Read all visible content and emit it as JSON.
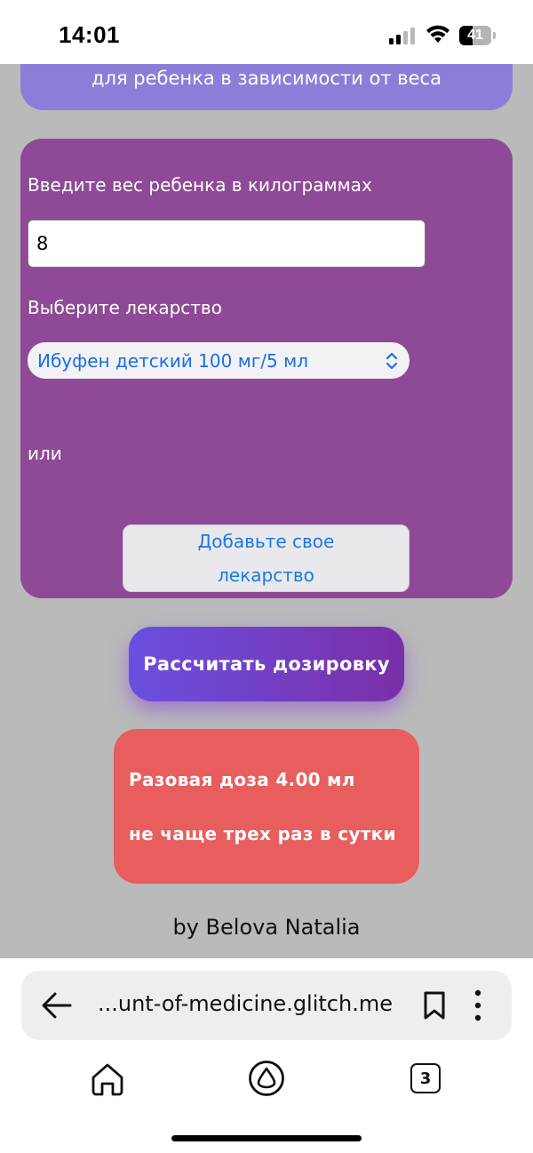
{
  "status_bar": {
    "time": "14:01",
    "battery": "41",
    "battery_level": 0.41,
    "icons": [
      "cellular-signal-icon",
      "wifi-icon",
      "battery-icon"
    ]
  },
  "header": {
    "text": "для ребенка в зависимости от веса"
  },
  "form": {
    "weight_label": "Введите вес ребенка в килограммах",
    "weight_value": "8",
    "medicine_label": "Выберите лекарство",
    "medicine_selected": "Ибуфен детский 100 мг/5 мл",
    "or_text": "или",
    "add_medicine_button": "Добавьте свое лекарство"
  },
  "calculate_button": "Рассчитать дозировку",
  "result": {
    "dose_line": "Разовая доза 4.00 мл",
    "frequency_line": "не чаще трех раз в сутки"
  },
  "footer": {
    "author": "by Belova Natalia"
  },
  "browser": {
    "url": "...unt-of-medicine.glitch.me",
    "tabs_count": "3",
    "icons": [
      "back-arrow-icon",
      "bookmark-icon",
      "more-vertical-icon",
      "home-icon",
      "alice-assistant-icon",
      "tabs-icon"
    ]
  },
  "colors": {
    "header_card": "#8a7fd8",
    "form_card": "#8e4a96",
    "page_background": "#bababa",
    "result_card": "#e85d5d",
    "link_blue": "#1a78e6"
  }
}
